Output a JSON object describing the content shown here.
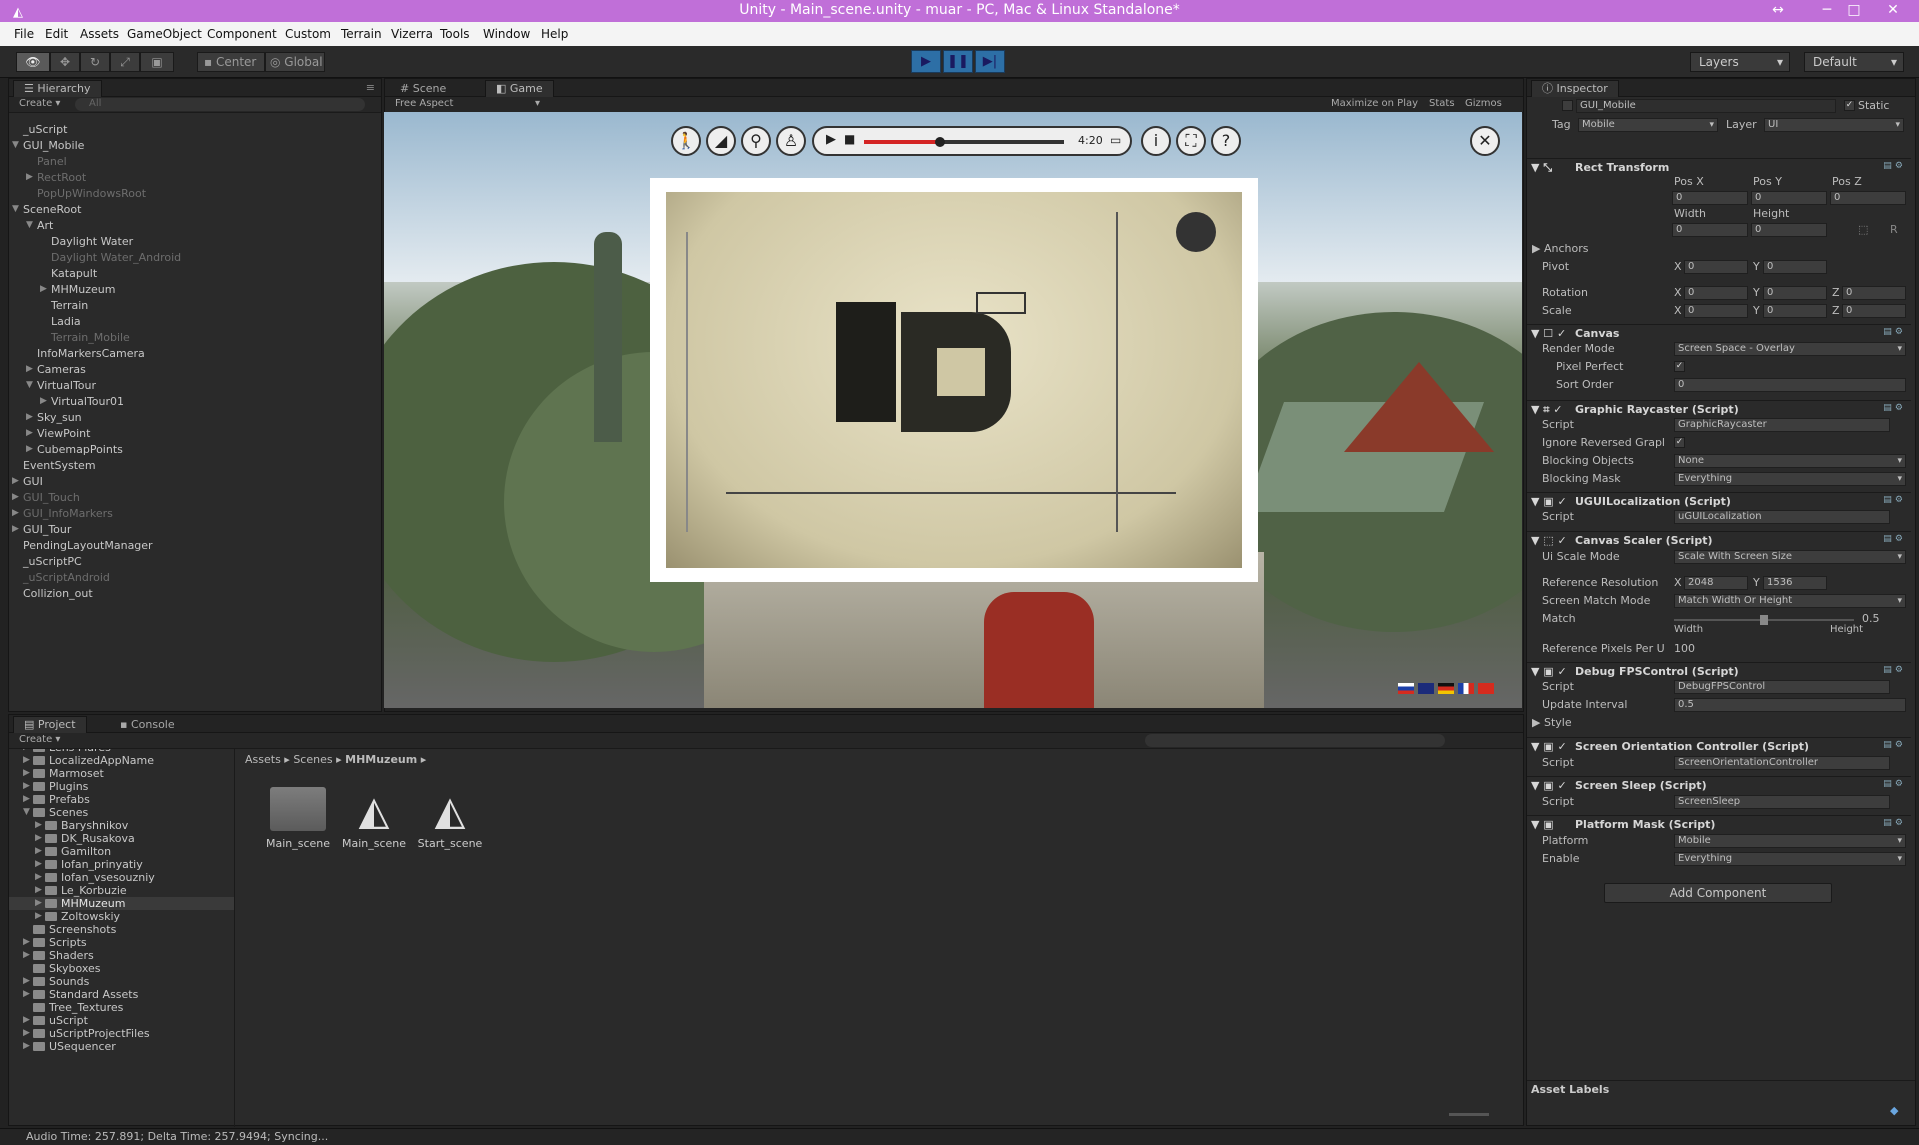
{
  "window": {
    "title": "Unity - Main_scene.unity - muar - PC, Mac & Linux Standalone*"
  },
  "menu": [
    "File",
    "Edit",
    "Assets",
    "GameObject",
    "Component",
    "Custom",
    "Terrain",
    "Vizerra",
    "Tools",
    "Window",
    "Help"
  ],
  "toolbar": {
    "pivot": "Center",
    "space": "Global",
    "layers": "Layers",
    "layout": "Default"
  },
  "hierarchy": {
    "tab": "Hierarchy",
    "create": "Create",
    "search": "All",
    "items": [
      {
        "label": "_uScript",
        "indent": 0,
        "dim": false,
        "arrow": ""
      },
      {
        "label": "GUI_Mobile",
        "indent": 0,
        "dim": false,
        "arrow": "▼"
      },
      {
        "label": "Panel",
        "indent": 1,
        "dim": true,
        "arrow": ""
      },
      {
        "label": "RectRoot",
        "indent": 1,
        "dim": true,
        "arrow": "▶"
      },
      {
        "label": "PopUpWindowsRoot",
        "indent": 1,
        "dim": true,
        "arrow": ""
      },
      {
        "label": "SceneRoot",
        "indent": 0,
        "dim": false,
        "arrow": "▼"
      },
      {
        "label": "Art",
        "indent": 1,
        "dim": false,
        "arrow": "▼"
      },
      {
        "label": "Daylight Water",
        "indent": 2,
        "dim": false,
        "arrow": ""
      },
      {
        "label": "Daylight Water_Android",
        "indent": 2,
        "dim": true,
        "arrow": ""
      },
      {
        "label": "Katapult",
        "indent": 2,
        "dim": false,
        "arrow": ""
      },
      {
        "label": "MHMuzeum",
        "indent": 2,
        "dim": false,
        "arrow": "▶"
      },
      {
        "label": "Terrain",
        "indent": 2,
        "dim": false,
        "arrow": ""
      },
      {
        "label": "Ladia",
        "indent": 2,
        "dim": false,
        "arrow": ""
      },
      {
        "label": "Terrain_Mobile",
        "indent": 2,
        "dim": true,
        "arrow": ""
      },
      {
        "label": "InfoMarkersCamera",
        "indent": 1,
        "dim": false,
        "arrow": ""
      },
      {
        "label": "Cameras",
        "indent": 1,
        "dim": false,
        "arrow": "▶"
      },
      {
        "label": "VirtualTour",
        "indent": 1,
        "dim": false,
        "arrow": "▼"
      },
      {
        "label": "VirtualTour01",
        "indent": 2,
        "dim": false,
        "arrow": "▶"
      },
      {
        "label": "Sky_sun",
        "indent": 1,
        "dim": false,
        "arrow": "▶"
      },
      {
        "label": "ViewPoint",
        "indent": 1,
        "dim": false,
        "arrow": "▶"
      },
      {
        "label": "CubemapPoints",
        "indent": 1,
        "dim": false,
        "arrow": "▶"
      },
      {
        "label": "EventSystem",
        "indent": 0,
        "dim": false,
        "arrow": ""
      },
      {
        "label": "GUI",
        "indent": 0,
        "dim": false,
        "arrow": "▶"
      },
      {
        "label": "GUI_Touch",
        "indent": 0,
        "dim": true,
        "arrow": "▶"
      },
      {
        "label": "GUI_InfoMarkers",
        "indent": 0,
        "dim": true,
        "arrow": "▶"
      },
      {
        "label": "GUI_Tour",
        "indent": 0,
        "dim": false,
        "arrow": "▶"
      },
      {
        "label": "PendingLayoutManager",
        "indent": 0,
        "dim": false,
        "arrow": ""
      },
      {
        "label": "_uScriptPC",
        "indent": 0,
        "dim": false,
        "arrow": ""
      },
      {
        "label": "_uScriptAndroid",
        "indent": 0,
        "dim": true,
        "arrow": ""
      },
      {
        "label": "Collizion_out",
        "indent": 0,
        "dim": false,
        "arrow": ""
      }
    ]
  },
  "scene_tabs": {
    "scene": "Scene",
    "game": "Game",
    "aspect": "Free Aspect",
    "maximize": "Maximize on Play",
    "stats": "Stats",
    "gizmos": "Gizmos"
  },
  "game_ui": {
    "time": "4:20",
    "progress": 0.38
  },
  "project": {
    "tab": "Project",
    "console": "Console",
    "create": "Create",
    "breadcrumb": [
      "Assets",
      "Scenes",
      "MHMuzeum"
    ],
    "folders": [
      {
        "label": "Lens Flares",
        "indent": 1,
        "arrow": "▶",
        "sel": false
      },
      {
        "label": "LocalizedAppName",
        "indent": 1,
        "arrow": "▶",
        "sel": false
      },
      {
        "label": "Marmoset",
        "indent": 1,
        "arrow": "▶",
        "sel": false
      },
      {
        "label": "Plugins",
        "indent": 1,
        "arrow": "▶",
        "sel": false
      },
      {
        "label": "Prefabs",
        "indent": 1,
        "arrow": "▶",
        "sel": false
      },
      {
        "label": "Scenes",
        "indent": 1,
        "arrow": "▼",
        "sel": false
      },
      {
        "label": "Baryshnikov",
        "indent": 2,
        "arrow": "▶",
        "sel": false
      },
      {
        "label": "DK_Rusakova",
        "indent": 2,
        "arrow": "▶",
        "sel": false
      },
      {
        "label": "Gamilton",
        "indent": 2,
        "arrow": "▶",
        "sel": false
      },
      {
        "label": "Iofan_prinyatiy",
        "indent": 2,
        "arrow": "▶",
        "sel": false
      },
      {
        "label": "Iofan_vsesouzniy",
        "indent": 2,
        "arrow": "▶",
        "sel": false
      },
      {
        "label": "Le_Korbuzie",
        "indent": 2,
        "arrow": "▶",
        "sel": false
      },
      {
        "label": "MHMuzeum",
        "indent": 2,
        "arrow": "▶",
        "sel": true
      },
      {
        "label": "Zoltowskiy",
        "indent": 2,
        "arrow": "▶",
        "sel": false
      },
      {
        "label": "Screenshots",
        "indent": 1,
        "arrow": "",
        "sel": false
      },
      {
        "label": "Scripts",
        "indent": 1,
        "arrow": "▶",
        "sel": false
      },
      {
        "label": "Shaders",
        "indent": 1,
        "arrow": "▶",
        "sel": false
      },
      {
        "label": "Skyboxes",
        "indent": 1,
        "arrow": "",
        "sel": false
      },
      {
        "label": "Sounds",
        "indent": 1,
        "arrow": "▶",
        "sel": false
      },
      {
        "label": "Standard Assets",
        "indent": 1,
        "arrow": "▶",
        "sel": false
      },
      {
        "label": "Tree_Textures",
        "indent": 1,
        "arrow": "",
        "sel": false
      },
      {
        "label": "uScript",
        "indent": 1,
        "arrow": "▶",
        "sel": false
      },
      {
        "label": "uScriptProjectFiles",
        "indent": 1,
        "arrow": "▶",
        "sel": false
      },
      {
        "label": "USequencer",
        "indent": 1,
        "arrow": "▶",
        "sel": false
      }
    ],
    "assets": [
      {
        "label": "Main_scene",
        "type": "folder"
      },
      {
        "label": "Main_scene",
        "type": "unity"
      },
      {
        "label": "Start_scene",
        "type": "unity"
      }
    ]
  },
  "inspector": {
    "tab": "Inspector",
    "object": "GUI_Mobile",
    "static": "Static",
    "tag_label": "Tag",
    "tag": "Mobile",
    "layer_label": "Layer",
    "layer": "UI",
    "rect": {
      "title": "Rect Transform",
      "posx": "Pos X",
      "posy": "Pos Y",
      "posz": "Pos Z",
      "px": "0",
      "py": "0",
      "pz": "0",
      "width": "Width",
      "height": "Height",
      "w": "0",
      "h": "0",
      "anchors": "Anchors",
      "pivot": "Pivot",
      "rotation": "Rotation",
      "scale": "Scale",
      "x": "X",
      "y": "Y",
      "z": "Z",
      "pivx": "0",
      "pivy": "0",
      "rotx": "0",
      "roty": "0",
      "rotz": "0",
      "scx": "0",
      "scy": "0",
      "scz": "0",
      "r": "R"
    },
    "canvas": {
      "title": "Canvas",
      "render_mode": "Render Mode",
      "render_val": "Screen Space - Overlay",
      "pixel": "Pixel Perfect",
      "sort": "Sort Order",
      "sort_val": "0"
    },
    "raycaster": {
      "title": "Graphic Raycaster (Script)",
      "script": "Script",
      "script_val": "GraphicRaycaster",
      "ignore": "Ignore Reversed Grapl",
      "blocking": "Blocking Objects",
      "blocking_val": "None",
      "mask": "Blocking Mask",
      "mask_val": "Everything"
    },
    "localization": {
      "title": "UGUILocalization (Script)",
      "script": "Script",
      "script_val": "uGUILocalization"
    },
    "scaler": {
      "title": "Canvas Scaler (Script)",
      "mode": "Ui Scale Mode",
      "mode_val": "Scale With Screen Size",
      "ref": "Reference Resolution",
      "rx": "2048",
      "ry": "1536",
      "match_mode": "Screen Match Mode",
      "match_mode_val": "Match Width Or Height",
      "match": "Match",
      "match_val": "0.5",
      "width": "Width",
      "height": "Height",
      "ppu": "Reference Pixels Per U",
      "ppu_val": "100"
    },
    "fps": {
      "title": "Debug FPSControl (Script)",
      "script": "Script",
      "script_val": "DebugFPSControl",
      "interval": "Update Interval",
      "interval_val": "0.5",
      "style": "Style"
    },
    "orientation": {
      "title": "Screen Orientation Controller (Script)",
      "script": "Script",
      "script_val": "ScreenOrientationController"
    },
    "sleep": {
      "title": "Screen Sleep (Script)",
      "script": "Script",
      "script_val": "ScreenSleep"
    },
    "platform": {
      "title": "Platform Mask (Script)",
      "platform": "Platform",
      "platform_val": "Mobile",
      "enable": "Enable",
      "enable_val": "Everything"
    },
    "add": "Add Component",
    "labels": "Asset Labels"
  },
  "status": "Audio Time: 257.891; Delta Time: 257.9494; Syncing..."
}
